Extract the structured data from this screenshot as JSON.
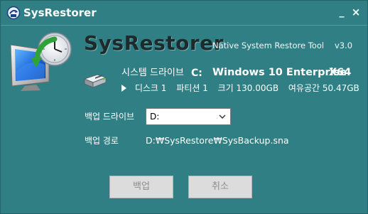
{
  "window": {
    "title": "SysRestorer",
    "minimize_glyph": "_",
    "close_glyph": "×"
  },
  "header": {
    "app_name": "SysRestorer",
    "description": "Native System Restore Tool",
    "version": "v3.0",
    "icon": "computer-restore-clock-icon"
  },
  "system": {
    "label": "시스템 드라이브",
    "drive_letter": "C:",
    "os_name": "Windows 10 Enterprise",
    "os_arch": "X64",
    "icon": "hard-drive-icon",
    "disk": {
      "disk_label": "디스크 1",
      "partition_label": "파티션 1",
      "size_label": "크기 130.00GB",
      "free_label": "여유공간 50.47GB"
    }
  },
  "backup": {
    "drive_label": "백업 드라이브",
    "drive_selected": "D:",
    "path_label": "백업 경로",
    "path_value": "D:₩SysRestore₩SysBackup.sna"
  },
  "buttons": {
    "backup_label": "백업",
    "cancel_label": "취소"
  },
  "colors": {
    "background": "#2f7f84",
    "button_bg": "#dcdcdc",
    "button_text": "#8e8e8e",
    "text": "#ffffff"
  }
}
